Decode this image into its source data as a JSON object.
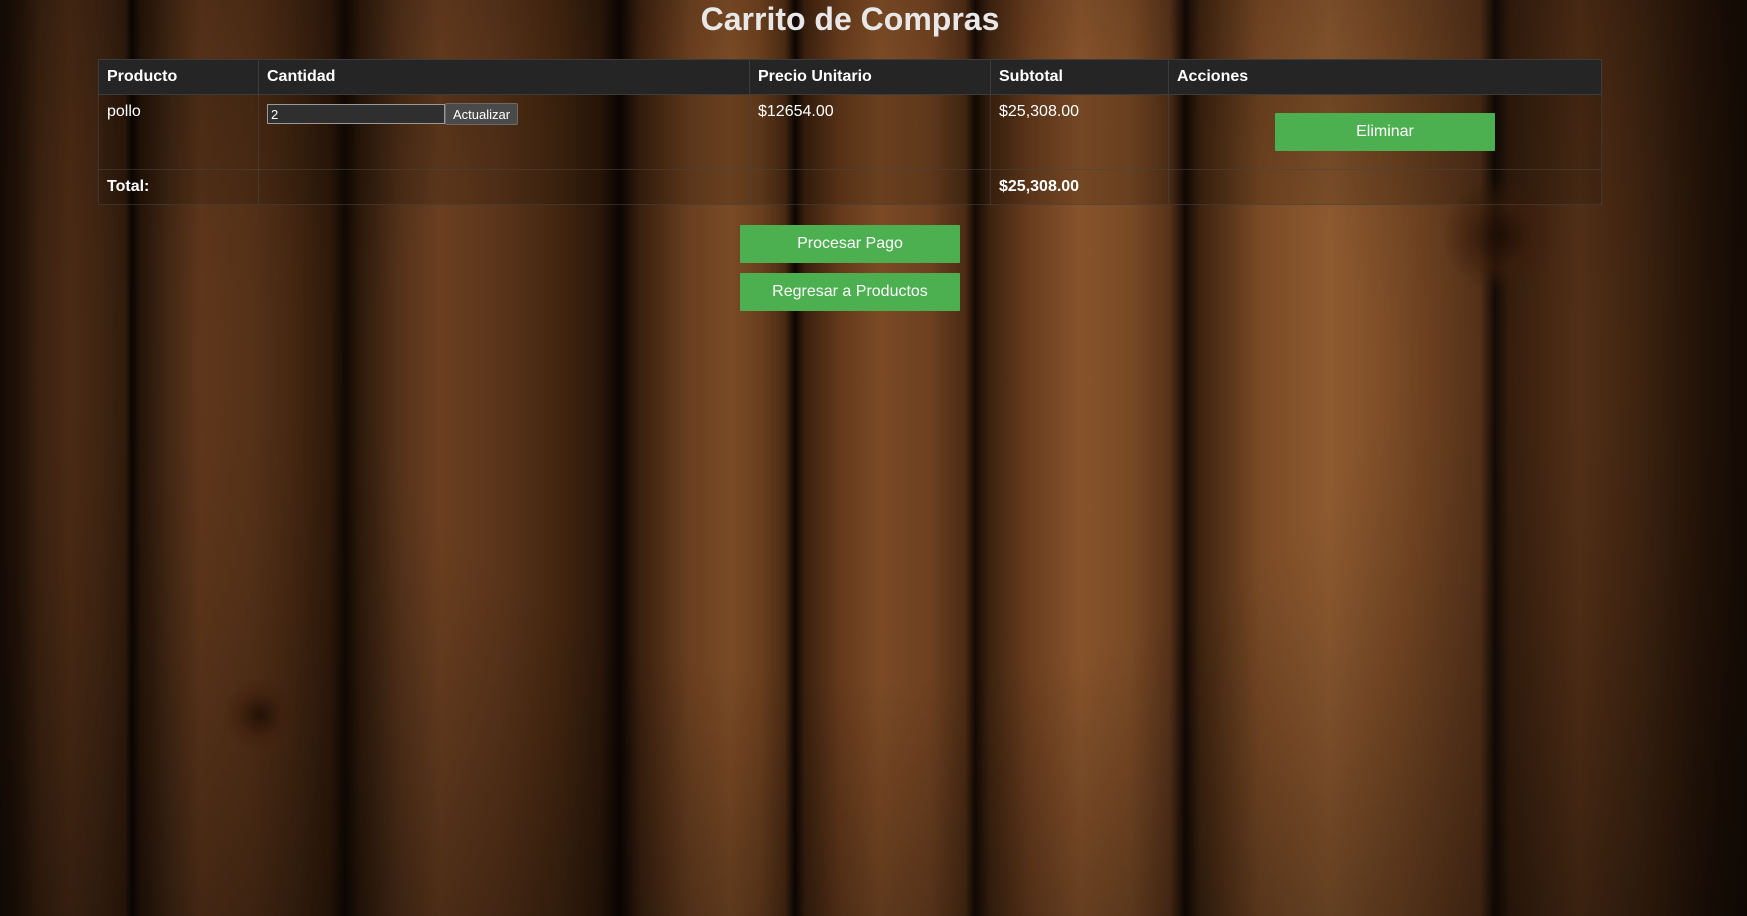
{
  "page": {
    "title": "Carrito de Compras"
  },
  "table": {
    "headers": {
      "product": "Producto",
      "quantity": "Cantidad",
      "unit_price": "Precio Unitario",
      "subtotal": "Subtotal",
      "actions": "Acciones"
    },
    "items": [
      {
        "product": "pollo",
        "quantity": "2",
        "update_label": "Actualizar",
        "unit_price": "$12654.00",
        "subtotal": "$25,308.00",
        "delete_label": "Eliminar"
      }
    ],
    "total_label": "Total:",
    "total_value": "$25,308.00"
  },
  "actions": {
    "process_payment": "Procesar Pago",
    "back_to_products": "Regresar a Productos"
  },
  "colors": {
    "button_green": "#4caf50",
    "header_bg": "#252525"
  }
}
